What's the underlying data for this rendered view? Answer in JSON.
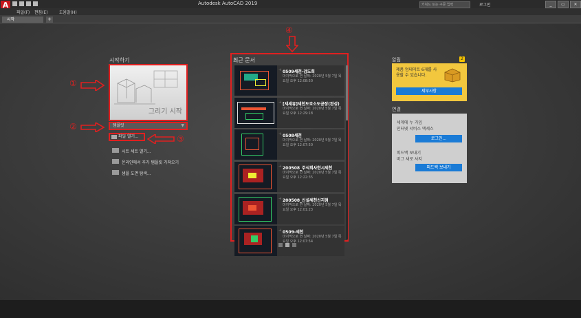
{
  "app": {
    "logo_letter": "A",
    "title": "Autodesk AutoCAD 2019"
  },
  "header": {
    "search_placeholder": "키워드 또는 구문 입력",
    "signin_label": "로그인",
    "win_buttons": [
      "_",
      "▭",
      "✕"
    ]
  },
  "menu": {
    "items": [
      "파일(F)",
      "편집(E)",
      "도움말(H)"
    ]
  },
  "tabs": {
    "active": "시작",
    "add_label": "+"
  },
  "getting_started": {
    "title": "시작하기",
    "draw_label": "그리기 시작",
    "template_label": "템플릿",
    "open_files_label": "파일 열기...",
    "links": [
      "시트 세트 열기...",
      "온라인에서 추가 템플릿 가져오기",
      "샘플 도면 탐색..."
    ]
  },
  "recent": {
    "title": "최근 문서",
    "docs": [
      {
        "name": "0509세천-검도회",
        "meta": "마지막으로 연 날짜: 2020년 5월 7일 목요일 오후 12:08:50"
      },
      {
        "name": "[세세유]세천도호소도공장(완성)",
        "meta": "마지막으로 연 날짜: 2020년 5월 7일 목요일 오후 12:29:18"
      },
      {
        "name": "0508세천",
        "meta": "마지막으로 연 날짜: 2020년 5월 7일 목요일 오후 12:07:50"
      },
      {
        "name": "200508_주식회사한시세천",
        "meta": "마지막으로 연 날짜: 2020년 5월 7일 목요일 오후 12:22:35"
      },
      {
        "name": "200508_신설세천신지점",
        "meta": "마지막으로 연 날짜: 2020년 5월 7일 목요일 오후 12:01:23"
      },
      {
        "name": "0509-세천",
        "meta": "마지막으로 연 날짜: 2020년 5월 7일 목요일 오후 12:07:54"
      }
    ]
  },
  "notifications": {
    "title": "알림",
    "badge": "2",
    "text": "제품 업데이트 6개를 사용할 수 있습니다.",
    "button": "세부사항"
  },
  "connect": {
    "title": "연결",
    "signin_text1": "세계에 누 가입",
    "signin_text2": "인터넷 서비스 액세스",
    "signin_button": "로그인...",
    "feedback_title": "피드백 보내기",
    "feedback_sub": "버그 새로 사지",
    "feedback_button": "피드백 보내기"
  },
  "markers": {
    "m1": "①",
    "m2": "②",
    "m3": "③",
    "m4": "④"
  },
  "colors": {
    "highlight": "#e02020",
    "accent": "#1a7bd6",
    "notification": "#f2c73e"
  }
}
